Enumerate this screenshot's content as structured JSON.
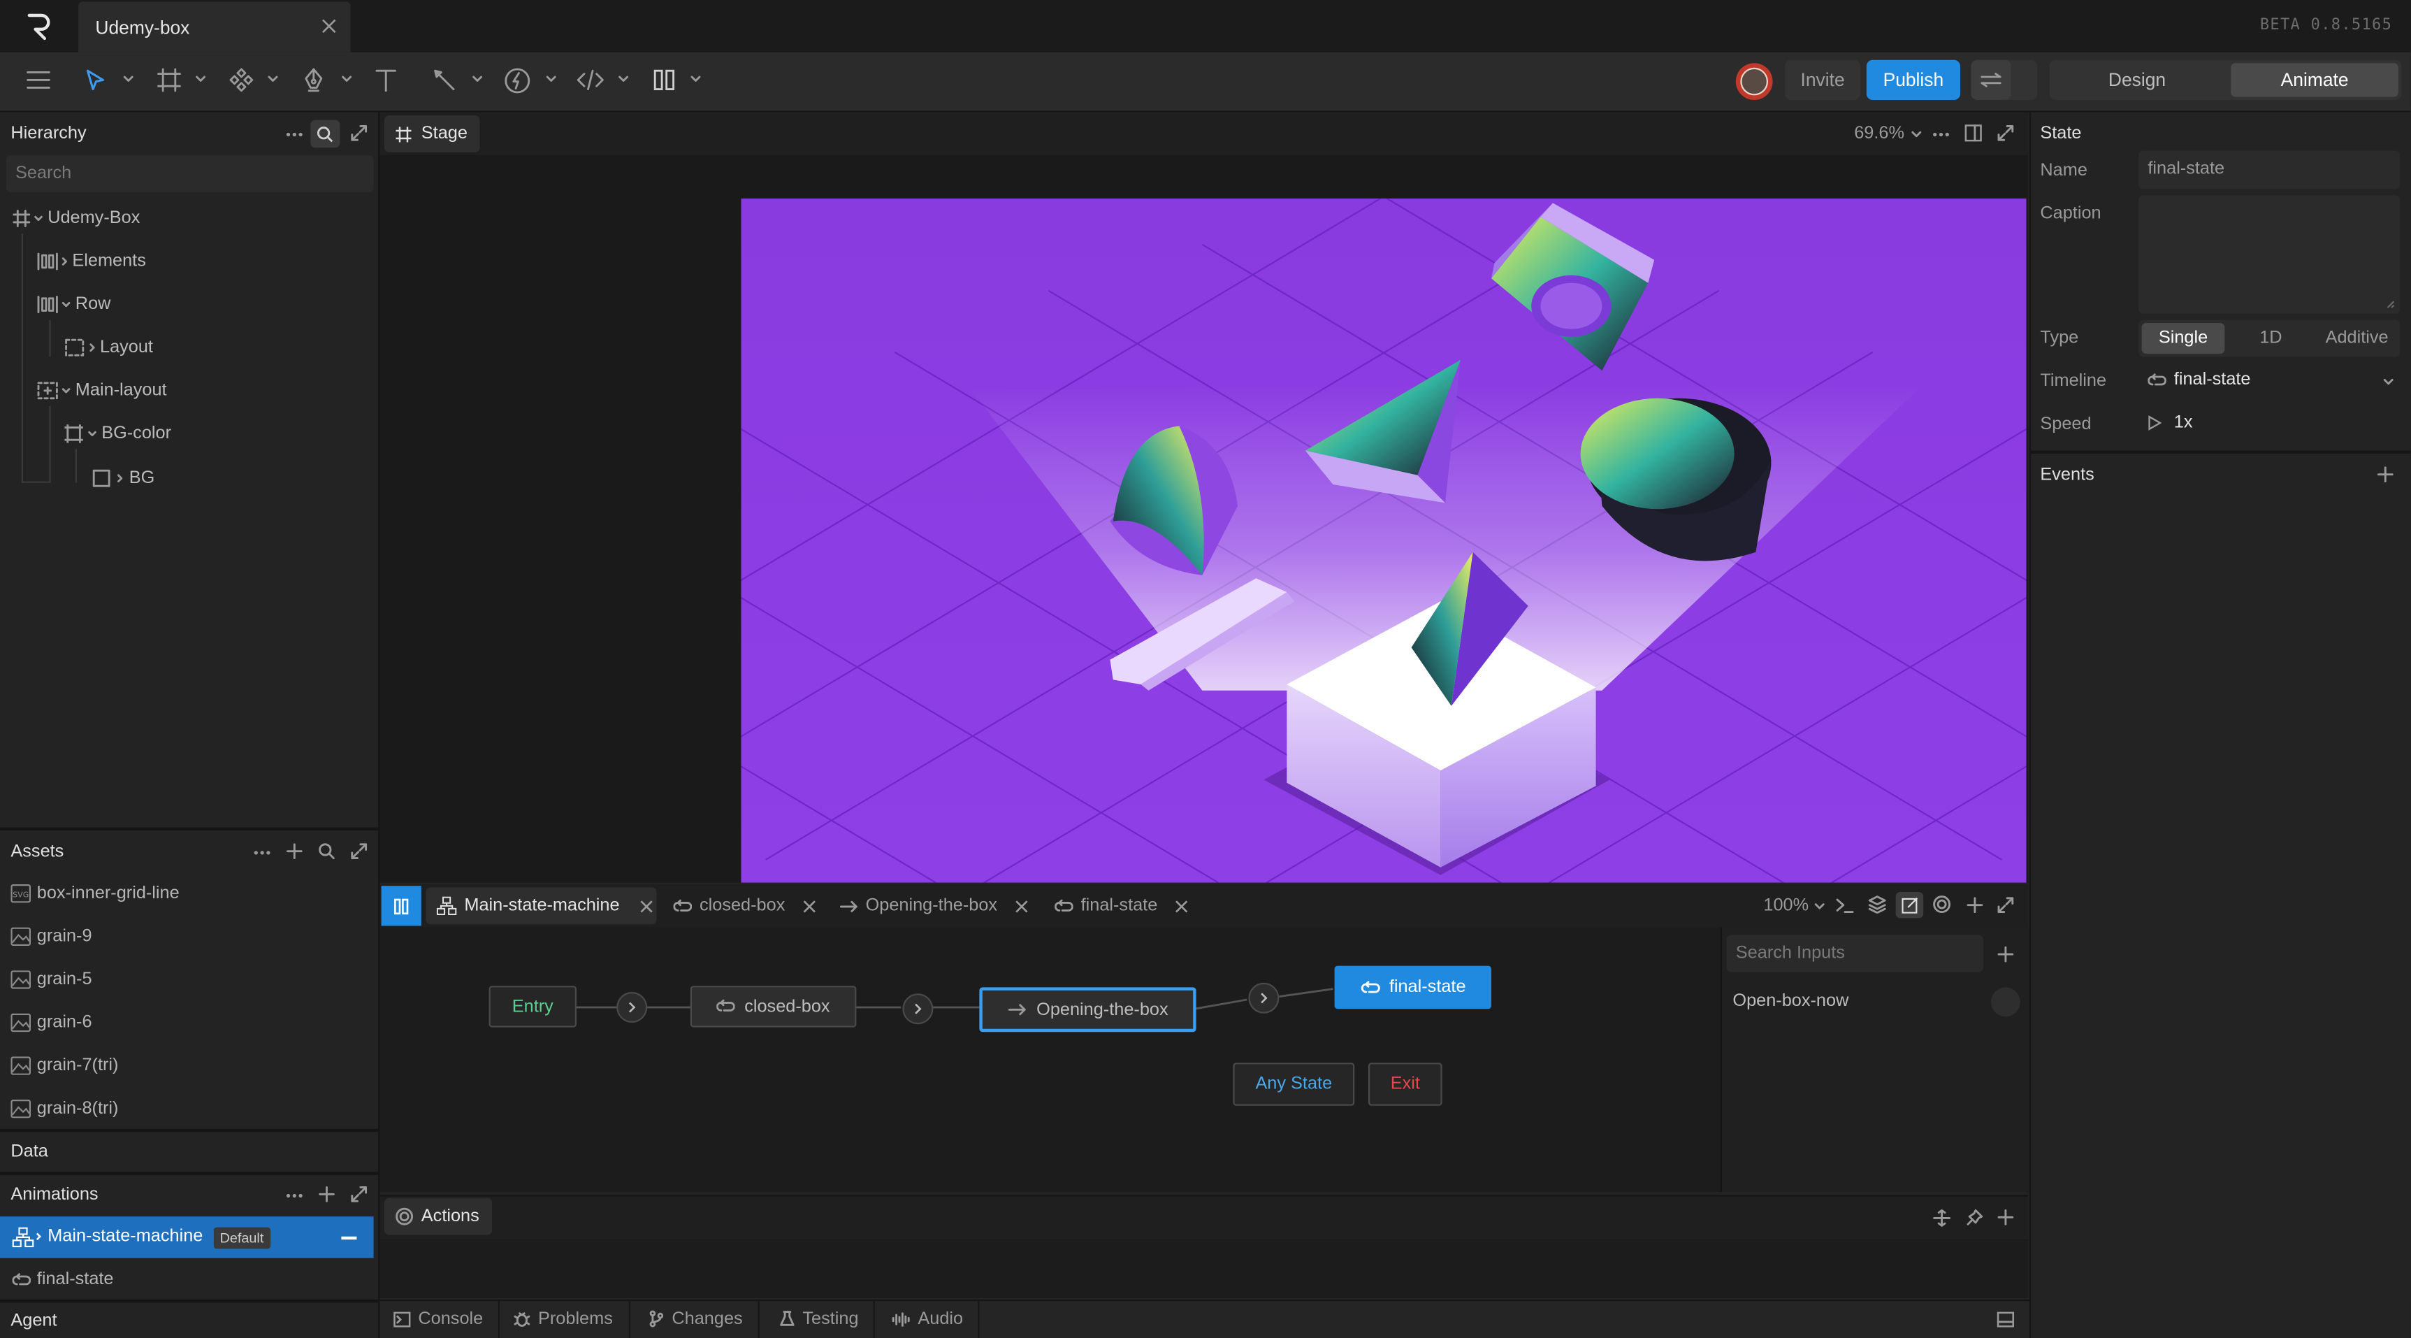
{
  "app": {
    "beta": "BETA 0.8.5165",
    "document_tab": "Udemy-box"
  },
  "toolbar": {
    "invite": "Invite",
    "publish": "Publish",
    "mode_design": "Design",
    "mode_animate": "Animate"
  },
  "hierarchy": {
    "title": "Hierarchy",
    "search_placeholder": "Search",
    "items": [
      {
        "label": "Udemy-Box"
      },
      {
        "label": "Elements"
      },
      {
        "label": "Row"
      },
      {
        "label": "Layout"
      },
      {
        "label": "Main-layout"
      },
      {
        "label": "BG-color"
      },
      {
        "label": "BG"
      }
    ]
  },
  "assets": {
    "title": "Assets",
    "items": [
      "box-inner-grid-line",
      "grain-9",
      "grain-5",
      "grain-6",
      "grain-7(tri)",
      "grain-8(tri)"
    ]
  },
  "data_section": {
    "title": "Data"
  },
  "animations": {
    "title": "Animations",
    "items": [
      {
        "label": "Main-state-machine",
        "badge": "Default"
      },
      {
        "label": "final-state"
      }
    ]
  },
  "agent": {
    "title": "Agent"
  },
  "stage": {
    "tab": "Stage",
    "zoom": "69.6%"
  },
  "state_machine": {
    "tabs": [
      "Main-state-machine",
      "closed-box",
      "Opening-the-box",
      "final-state"
    ],
    "zoom": "100%",
    "nodes": {
      "entry": "Entry",
      "closed": "closed-box",
      "opening": "Opening-the-box",
      "final": "final-state",
      "any": "Any State",
      "exit": "Exit"
    },
    "inputs_search_placeholder": "Search Inputs",
    "inputs": [
      "Open-box-now"
    ]
  },
  "actions": {
    "tab": "Actions"
  },
  "bottom_tabs": [
    "Console",
    "Problems",
    "Changes",
    "Testing",
    "Audio"
  ],
  "inspector": {
    "title": "State",
    "name_label": "Name",
    "name_value": "final-state",
    "caption_label": "Caption",
    "type_label": "Type",
    "type_options": [
      "Single",
      "1D",
      "Additive"
    ],
    "type_selected": "Single",
    "timeline_label": "Timeline",
    "timeline_value": "final-state",
    "speed_label": "Speed",
    "speed_value": "1x",
    "events_title": "Events"
  },
  "colors": {
    "accent": "#1f8adf",
    "artboard": "#8a3be0",
    "entry": "#5bd08e",
    "exit": "#e5484d",
    "any_state": "#4aa8e8"
  }
}
